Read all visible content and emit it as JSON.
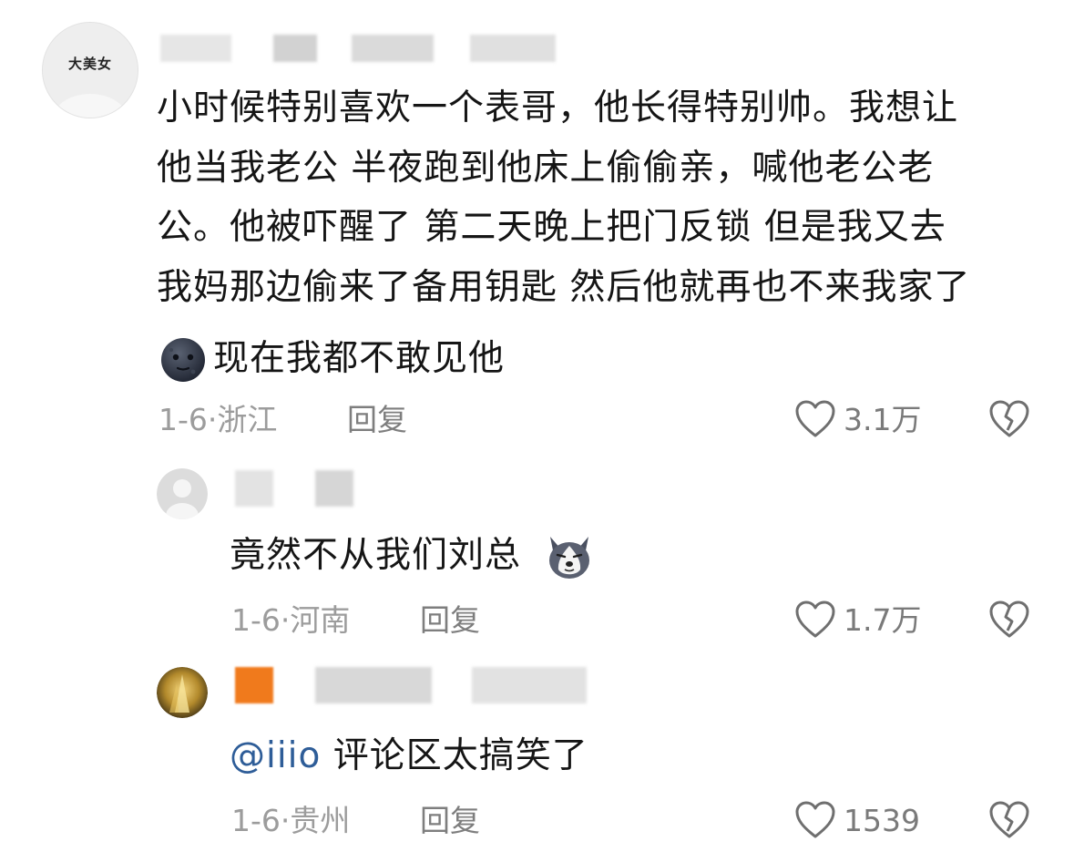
{
  "comments": [
    {
      "avatar_text": "大美女",
      "body_lines": [
        "小时候特别喜欢一个表哥，他长得特别帅。我想让",
        "他当我老公 半夜跑到他床上偷偷亲，喊他老公老",
        "公。他被吓醒了 第二天晚上把门反锁 但是我又去",
        "我妈那边偷来了备用钥匙 然后他就再也不来我家了"
      ],
      "last_line": "现在我都不敢见他",
      "emoji": "dark-moon-face",
      "date": "1-6",
      "location": "浙江",
      "reply_label": "回复",
      "likes": "3.1万"
    },
    {
      "body": "竟然不从我们刘总",
      "emoji": "husky-dog-face",
      "date": "1-6",
      "location": "河南",
      "reply_label": "回复",
      "likes": "1.7万"
    },
    {
      "mention": "@iiio",
      "body": "评论区太搞笑了",
      "date": "1-6",
      "location": "贵州",
      "reply_label": "回复",
      "likes": "1539"
    }
  ],
  "colors": {
    "mention": "#2e5d98",
    "meta": "#9c9c9c",
    "username_accent": "#f07a1c"
  }
}
